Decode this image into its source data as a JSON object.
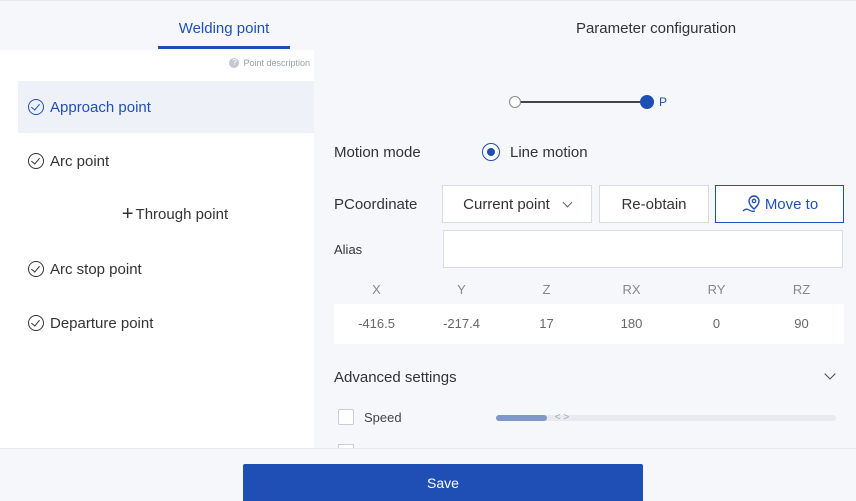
{
  "tabs": [
    {
      "label": "Welding point",
      "active": true
    },
    {
      "label": "Parameter configuration",
      "active": false
    }
  ],
  "sidebar": {
    "help": {
      "icon": "help-icon",
      "text": "Point description"
    },
    "items": [
      {
        "label": "Approach point",
        "icon": "check-circle-icon",
        "active": true
      },
      {
        "label": "Arc point",
        "icon": "check-circle-icon",
        "active": false
      },
      {
        "label": "Through point",
        "icon": "plus-icon",
        "active": false
      },
      {
        "label": "Arc stop point",
        "icon": "check-circle-icon",
        "active": false
      },
      {
        "label": "Departure point",
        "icon": "check-circle-icon",
        "active": false
      }
    ]
  },
  "main": {
    "point_slider": {
      "end_label": "P"
    },
    "motion": {
      "label": "Motion mode",
      "option": "Line motion",
      "selected": true
    },
    "pcoordinate": {
      "label": "PCoordinate",
      "select_value": "Current point",
      "reobtain_label": "Re-obtain",
      "move_label": "Move to"
    },
    "alias": {
      "label": "Alias",
      "value": "",
      "placeholder": ""
    },
    "coordinates": {
      "headers": [
        "X",
        "Y",
        "Z",
        "RX",
        "RY",
        "RZ"
      ],
      "values": [
        "-416.5",
        "-217.4",
        "17",
        "180",
        "0",
        "90"
      ]
    },
    "advanced": {
      "label": "Advanced settings",
      "expanded": false
    },
    "speed": {
      "label": "Speed",
      "checked": false,
      "level_fraction": 0.15,
      "thumb_text": "< >"
    }
  },
  "footer": {
    "save_label": "Save"
  },
  "colors": {
    "accent": "#1f4fb5",
    "panel_bg": "#f6f7fa"
  }
}
